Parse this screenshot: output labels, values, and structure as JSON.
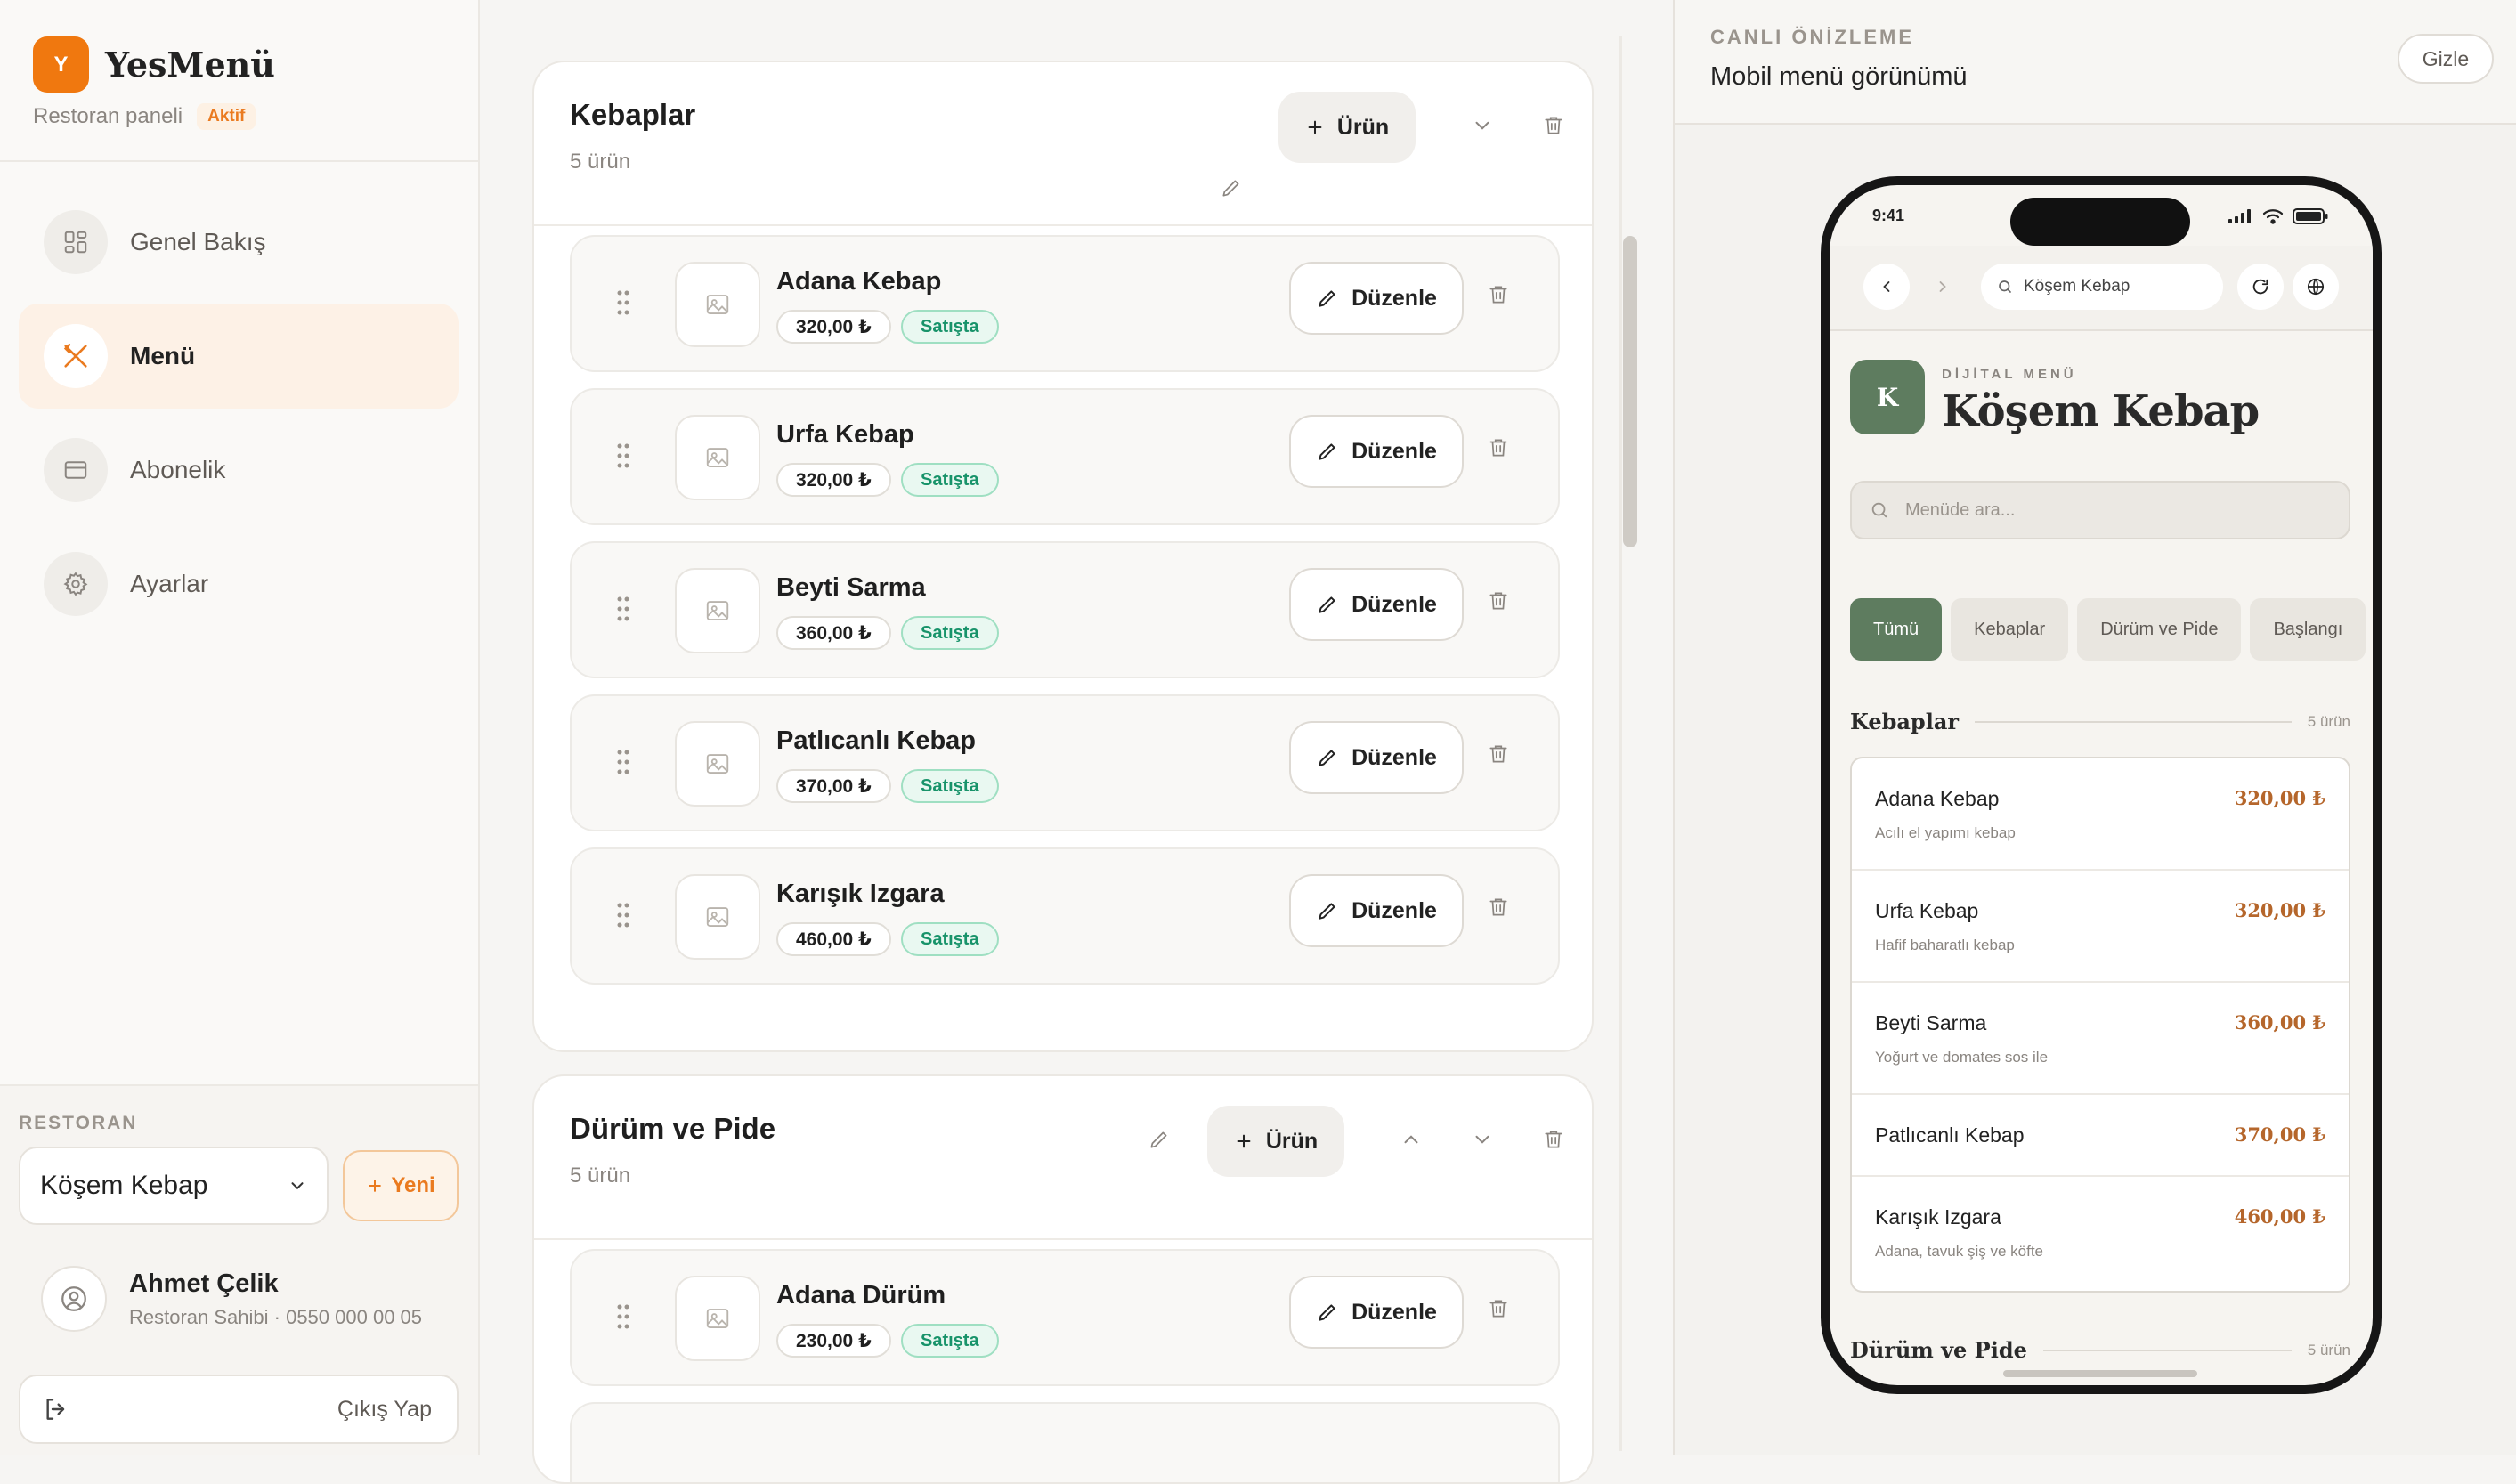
{
  "app": {
    "logo_letter": "Y",
    "name": "YesMenü",
    "subtitle": "Restoran paneli",
    "status_badge": "Aktif",
    "accent": "#f0780f"
  },
  "nav": [
    {
      "label": "Genel Bakış",
      "icon": "grid-icon"
    },
    {
      "label": "Menü",
      "icon": "utensils-icon",
      "active": true
    },
    {
      "label": "Abonelik",
      "icon": "credit-card-icon"
    },
    {
      "label": "Ayarlar",
      "icon": "gear-icon"
    }
  ],
  "restaurant": {
    "section_label": "RESTORAN",
    "selected": "Köşem Kebap",
    "new_label": "Yeni"
  },
  "user": {
    "name": "Ahmet Çelik",
    "meta": "Restoran Sahibi · 0550 000 00 05"
  },
  "logout_label": "Çıkış Yap",
  "categories": [
    {
      "title": "Kebaplar",
      "count": "5 ürün",
      "add_label": "Ürün",
      "items": [
        {
          "name": "Adana Kebap",
          "price": "320,00 ₺",
          "status": "Satışta"
        },
        {
          "name": "Urfa Kebap",
          "price": "320,00 ₺",
          "status": "Satışta"
        },
        {
          "name": "Beyti Sarma",
          "price": "360,00 ₺",
          "status": "Satışta"
        },
        {
          "name": "Patlıcanlı Kebap",
          "price": "370,00 ₺",
          "status": "Satışta"
        },
        {
          "name": "Karışık Izgara",
          "price": "460,00 ₺",
          "status": "Satışta"
        }
      ]
    },
    {
      "title": "Dürüm ve Pide",
      "count": "5 ürün",
      "add_label": "Ürün",
      "items": [
        {
          "name": "Adana Dürüm",
          "price": "230,00 ₺",
          "status": "Satışta"
        }
      ]
    }
  ],
  "edit_label": "Düzenle",
  "preview": {
    "label": "CANLI ÖNİZLEME",
    "title": "Mobil menü görünümü",
    "hide_label": "Gizle",
    "phone": {
      "time": "9:41",
      "url": "Köşem Kebap",
      "logo_letter": "K",
      "menu_label": "DİJİTAL MENÜ",
      "restaurant_name": "Köşem Kebap",
      "search_placeholder": "Menüde ara...",
      "chips": [
        "Tümü",
        "Kebaplar",
        "Dürüm ve Pide",
        "Başlangı"
      ],
      "sections": [
        {
          "title": "Kebaplar",
          "count": "5 ürün",
          "items": [
            {
              "name": "Adana Kebap",
              "desc": "Acılı el yapımı kebap",
              "price": "320,00 ₺"
            },
            {
              "name": "Urfa Kebap",
              "desc": "Hafif baharatlı kebap",
              "price": "320,00 ₺"
            },
            {
              "name": "Beyti Sarma",
              "desc": "Yoğurt ve domates sos ile",
              "price": "360,00 ₺"
            },
            {
              "name": "Patlıcanlı Kebap",
              "desc": "",
              "price": "370,00 ₺"
            },
            {
              "name": "Karışık Izgara",
              "desc": "Adana, tavuk şiş ve köfte",
              "price": "460,00 ₺"
            }
          ]
        },
        {
          "title": "Dürüm ve Pide",
          "count": "5 ürün"
        }
      ],
      "theme_color": "#5e7c5f",
      "price_color": "#b5662b"
    }
  }
}
